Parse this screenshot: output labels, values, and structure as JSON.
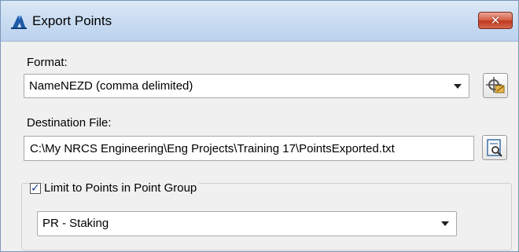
{
  "window": {
    "title": "Export Points",
    "close_label": "✕"
  },
  "format": {
    "label": "Format:",
    "selected": "NameNEZD (comma delimited)",
    "settings_icon": "point-file-format-icon"
  },
  "destination": {
    "label": "Destination File:",
    "value": "C:\\My NRCS Engineering\\Eng Projects\\Training 17\\PointsExported.txt",
    "browse_icon": "browse-file-icon"
  },
  "point_group": {
    "checkbox_label": "Limit to Points in Point Group",
    "checked": true,
    "selected": "PR - Staking"
  },
  "colors": {
    "title_bg": "#c9dcf1",
    "close_red": "#c0391f",
    "dialog_bg": "#f0f0f0"
  }
}
